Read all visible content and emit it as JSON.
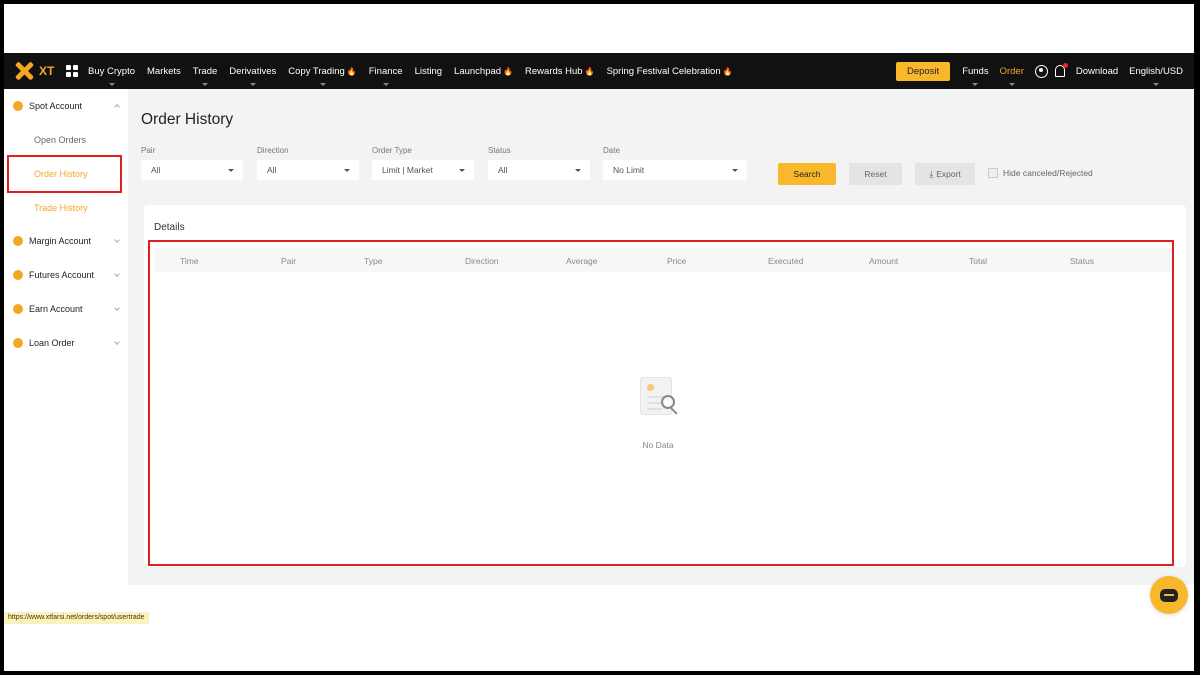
{
  "nav": {
    "logo_text": "XT",
    "items": [
      {
        "label": "Buy Crypto",
        "caret": true,
        "fire": false
      },
      {
        "label": "Markets",
        "caret": false,
        "fire": false
      },
      {
        "label": "Trade",
        "caret": true,
        "fire": false
      },
      {
        "label": "Derivatives",
        "caret": true,
        "fire": false
      },
      {
        "label": "Copy Trading",
        "caret": true,
        "fire": true
      },
      {
        "label": "Finance",
        "caret": true,
        "fire": false
      },
      {
        "label": "Listing",
        "caret": false,
        "fire": false
      },
      {
        "label": "Launchpad",
        "caret": false,
        "fire": true
      },
      {
        "label": "Rewards Hub",
        "caret": false,
        "fire": true
      },
      {
        "label": "Spring Festival Celebration",
        "caret": false,
        "fire": true
      }
    ],
    "deposit_label": "Deposit",
    "funds_label": "Funds",
    "order_label": "Order",
    "download_label": "Download",
    "locale_label": "English/USD"
  },
  "sidebar": {
    "groups": [
      {
        "label": "Spot Account"
      },
      {
        "label": "Margin Account"
      },
      {
        "label": "Futures Account"
      },
      {
        "label": "Earn Account"
      },
      {
        "label": "Loan Order"
      }
    ],
    "spot_sub": [
      {
        "label": "Open Orders"
      },
      {
        "label": "Order History"
      },
      {
        "label": "Trade History"
      }
    ]
  },
  "main": {
    "title": "Order History",
    "filters": [
      {
        "label": "Pair",
        "value": "All"
      },
      {
        "label": "Direction",
        "value": "All"
      },
      {
        "label": "Order Type",
        "value": "Limit | Market"
      },
      {
        "label": "Status",
        "value": "All"
      },
      {
        "label": "Date",
        "value": "No Limit"
      }
    ],
    "search_label": "Search",
    "reset_label": "Reset",
    "export_label": "Export",
    "hide_label": "Hide canceled/Rejected",
    "details_title": "Details",
    "columns": [
      "Time",
      "Pair",
      "Type",
      "Direction",
      "Average",
      "Price",
      "Executed",
      "Amount",
      "Total",
      "Status"
    ],
    "empty_text": "No Data"
  },
  "statusbar_url": "https://www.xtfarsi.net/orders/spot/usertrade",
  "colors": {
    "accent": "#f5a623",
    "highlight": "#e02020",
    "nav_bg": "#111111"
  }
}
